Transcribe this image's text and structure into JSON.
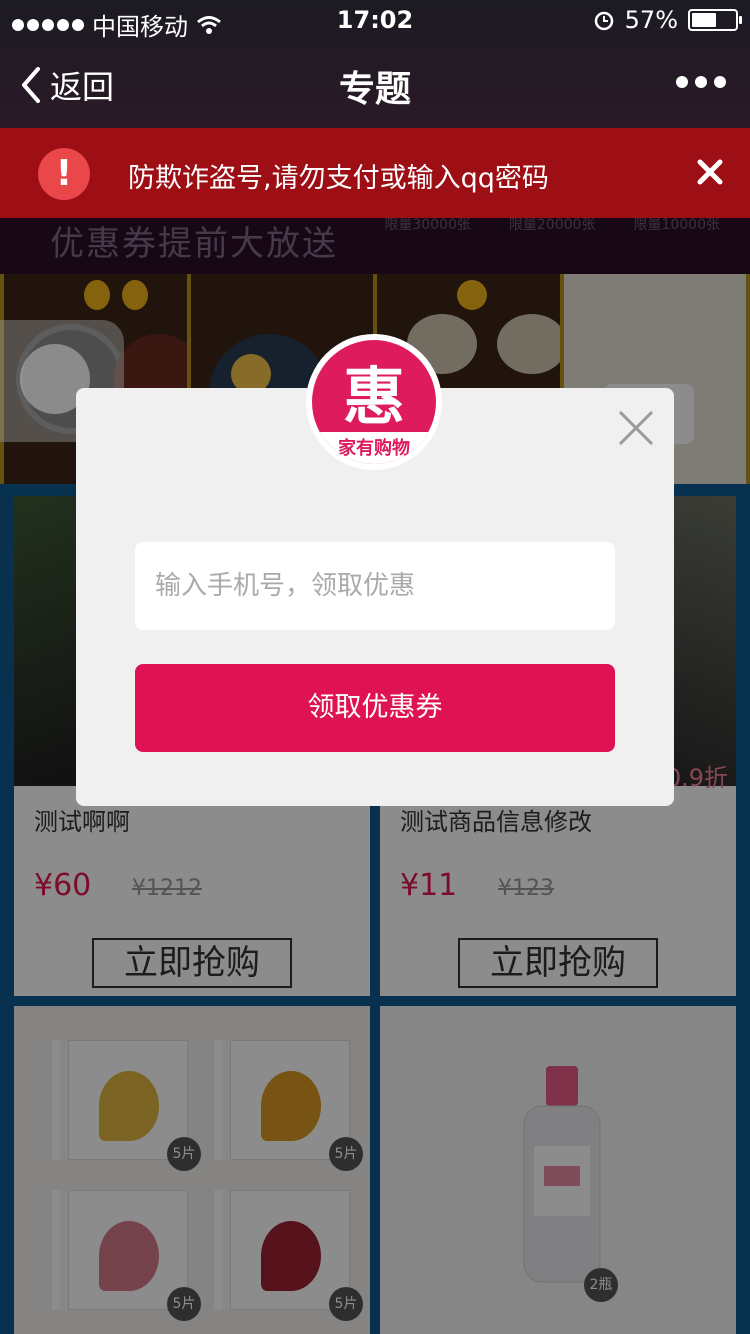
{
  "status": {
    "carrier": "中国移动",
    "time": "17:02",
    "battery": "57%"
  },
  "nav": {
    "back_label": "返回",
    "title": "专题"
  },
  "warning": {
    "text": "防欺诈盗号,请勿支付或输入qq密码"
  },
  "banner": {
    "promo": "优惠券提前大放送",
    "quotas": [
      "限量30000张",
      "限量20000张",
      "限量10000张"
    ]
  },
  "products": [
    {
      "name": "测试啊啊",
      "price": "¥60",
      "old_price": "¥1212",
      "buy_label": "立即抢购"
    },
    {
      "name": "测试商品信息修改",
      "price": "¥11",
      "old_price": "¥123",
      "buy_label": "立即抢购",
      "discount": "0.9折"
    }
  ],
  "modal": {
    "logo_glyph": "惠",
    "brand": "家有购物",
    "phone_placeholder": "输入手机号，领取优惠",
    "submit_label": "领取优惠券"
  },
  "masks": {
    "counts": [
      "5片",
      "5片",
      "5片",
      "5片"
    ]
  },
  "bottle": {
    "count": "2瓶"
  },
  "colors": {
    "accent": "#df1353",
    "warning": "#a80e14",
    "grid_bg": "#0f5a93"
  }
}
